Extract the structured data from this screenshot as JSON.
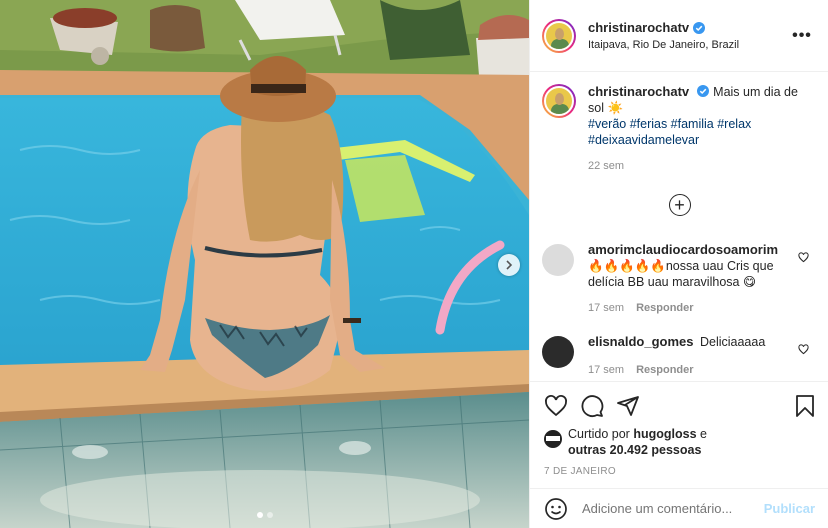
{
  "post": {
    "username": "christinarochatv",
    "location": "Itaipava, Rio De Janeiro, Brazil",
    "caption_text": "Mais um dia de sol",
    "caption_emoji": "☀️",
    "hashtags": "#verão #ferias #familia #relax #deixaavidamelevar",
    "caption_time": "22 sem",
    "more_label": "•••",
    "load_more": "+"
  },
  "comments": [
    {
      "username": "amorimclaudiocardosoamorim",
      "text": "🔥🔥🔥🔥🔥nossa uau Cris que delícia BB uau maravilhosa 😋",
      "time": "17 sem",
      "reply": "Responder",
      "avatar_color": "#d8d8d8"
    },
    {
      "username": "elisnaldo_gomes",
      "text": "Deliciaaaaa",
      "time": "17 sem",
      "reply": "Responder",
      "avatar_color": "#2b2b2b"
    }
  ],
  "likes": {
    "prefix": "Curtido por",
    "user": "hugogloss",
    "conj": "e",
    "others": "outras 20.492 pessoas"
  },
  "date": "7 DE JANEIRO",
  "composer": {
    "placeholder": "Adicione um comentário...",
    "post_label": "Publicar"
  },
  "carousel": {
    "current": 1,
    "total": 2
  },
  "colors": {
    "link": "#00376b",
    "verified": "#3897f0",
    "muted": "#8e8e8e"
  },
  "icons": [
    "heart-icon",
    "comment-icon",
    "share-icon",
    "bookmark-icon",
    "emoji-icon",
    "chevron-right-icon",
    "verified-badge-icon",
    "plus-circle-icon"
  ]
}
